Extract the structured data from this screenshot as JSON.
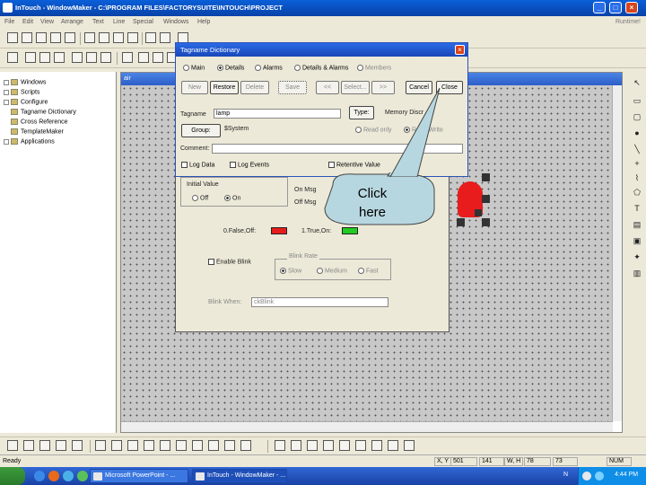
{
  "window": {
    "title": "InTouch - WindowMaker - C:\\PROGRAM FILES\\FACTORYSUITE\\INTOUCH\\PROJECT",
    "minimize": "_",
    "maximize": "□",
    "close": "×"
  },
  "menu": {
    "items": [
      "File",
      "Edit",
      "View",
      "Arrange",
      "Text",
      "Line",
      "Special",
      "Windows",
      "Help"
    ],
    "right_text": "Runtime!"
  },
  "tree": {
    "items": [
      {
        "label": "Windows",
        "expander": true
      },
      {
        "label": "Scripts",
        "expander": true
      },
      {
        "label": "Configure",
        "expander": true
      },
      {
        "label": "Tagname Dictionary",
        "expander": false
      },
      {
        "label": "Cross Reference",
        "expander": false
      },
      {
        "label": "TemplateMaker",
        "expander": false
      },
      {
        "label": "Applications",
        "expander": true
      }
    ]
  },
  "canvas": {
    "title": "air"
  },
  "tag_dialog": {
    "title": "Tagname Dictionary",
    "close": "×",
    "view_options": [
      {
        "label": "Main",
        "selected": false
      },
      {
        "label": "Details",
        "selected": true
      },
      {
        "label": "Alarms",
        "selected": false
      },
      {
        "label": "Details & Alarms",
        "selected": false
      },
      {
        "label": "Members",
        "selected": false
      }
    ],
    "buttons": {
      "new": "New",
      "restore": "Restore",
      "delete": "Delete",
      "save": "Save",
      "prev": "<<",
      "select": "Select...",
      "next": ">>",
      "cancel": "Cancel",
      "close": "Close"
    },
    "tagname_label": "Tagname",
    "tagname_value": "lamp",
    "type_button": "Type:",
    "type_value": "Memory Discr",
    "group_button": "Group:",
    "group_value": "$System",
    "access_options": [
      {
        "label": "Read only",
        "selected": false
      },
      {
        "label": "Read Write",
        "selected": true
      }
    ],
    "comment_label": "Comment:",
    "checkboxes": [
      "Log Data",
      "Log Events",
      "Retentive Value"
    ]
  },
  "init_value": {
    "label": "Initial Value",
    "options": [
      {
        "label": "Off",
        "selected": false
      },
      {
        "label": "On",
        "selected": true
      }
    ]
  },
  "prop_dialog": {
    "on_msg_label": "On Msg",
    "off_msg_label": "Off Msg",
    "false_label": "0.False,Off:",
    "true_label": "1.True,On:",
    "false_color": "#e81c1c",
    "true_color": "#22cc22",
    "enable_blink": "Enable Blink",
    "blink_rate_label": "Blink Rate",
    "blink_rates": [
      {
        "label": "Slow",
        "selected": true
      },
      {
        "label": "Medium",
        "selected": false
      },
      {
        "label": "Fast",
        "selected": false
      }
    ],
    "blink_when_label": "Blink When:",
    "blink_when_value": "ckBlink"
  },
  "callout": {
    "line1": "Click",
    "line2": "here"
  },
  "status": {
    "ready": "Ready",
    "xy_label": "X, Y",
    "x": "501",
    "y": "141",
    "wh_label": "W, H",
    "w": "78",
    "h": "73",
    "num": "NUM"
  },
  "taskbar": {
    "tasks": [
      "Microsoft PowerPoint - ...",
      "InTouch - WindowMaker - ..."
    ],
    "tray_letter": "N",
    "clock": "4:44 PM"
  },
  "colors": {
    "titlebar": "#0a5fd8",
    "accent": "#1947b8",
    "object_red": "#e81c1c",
    "callout_fill": "#b7d7e0"
  }
}
